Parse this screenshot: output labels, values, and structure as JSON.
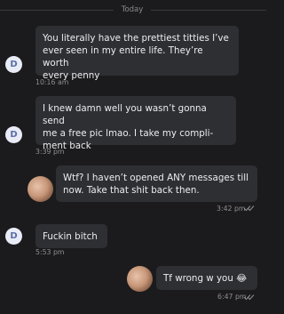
{
  "divider": {
    "label": "Today"
  },
  "messages": [
    {
      "direction": "in",
      "avatar_letter": "D",
      "lines": [
        "You literally have the prettiest titties I’ve",
        "ever seen in my entire life. They’re worth",
        "every penny"
      ],
      "time": "10:16 am"
    },
    {
      "direction": "in",
      "avatar_letter": "D",
      "lines": [
        "I knew damn well you wasn’t gonna send",
        "me a free pic lmao. I take my compli-",
        "ment back"
      ],
      "time": "3:39 pm"
    },
    {
      "direction": "out",
      "lines": [
        "Wtf? I haven’t opened ANY messages till",
        "now. Take that shit back then."
      ],
      "time": "3:42 pm"
    },
    {
      "direction": "in",
      "avatar_letter": "D",
      "lines": [
        "Fuckin bitch"
      ],
      "time": "5:53 pm"
    },
    {
      "direction": "out",
      "lines": [
        "Tf wrong w you 😂"
      ],
      "time": "6:47 pm"
    }
  ],
  "colors": {
    "background": "#1b1b1d",
    "bubble": "#2e2f33",
    "avatar_bg": "#e9ecf6",
    "avatar_letter": "#5a6ea6"
  }
}
